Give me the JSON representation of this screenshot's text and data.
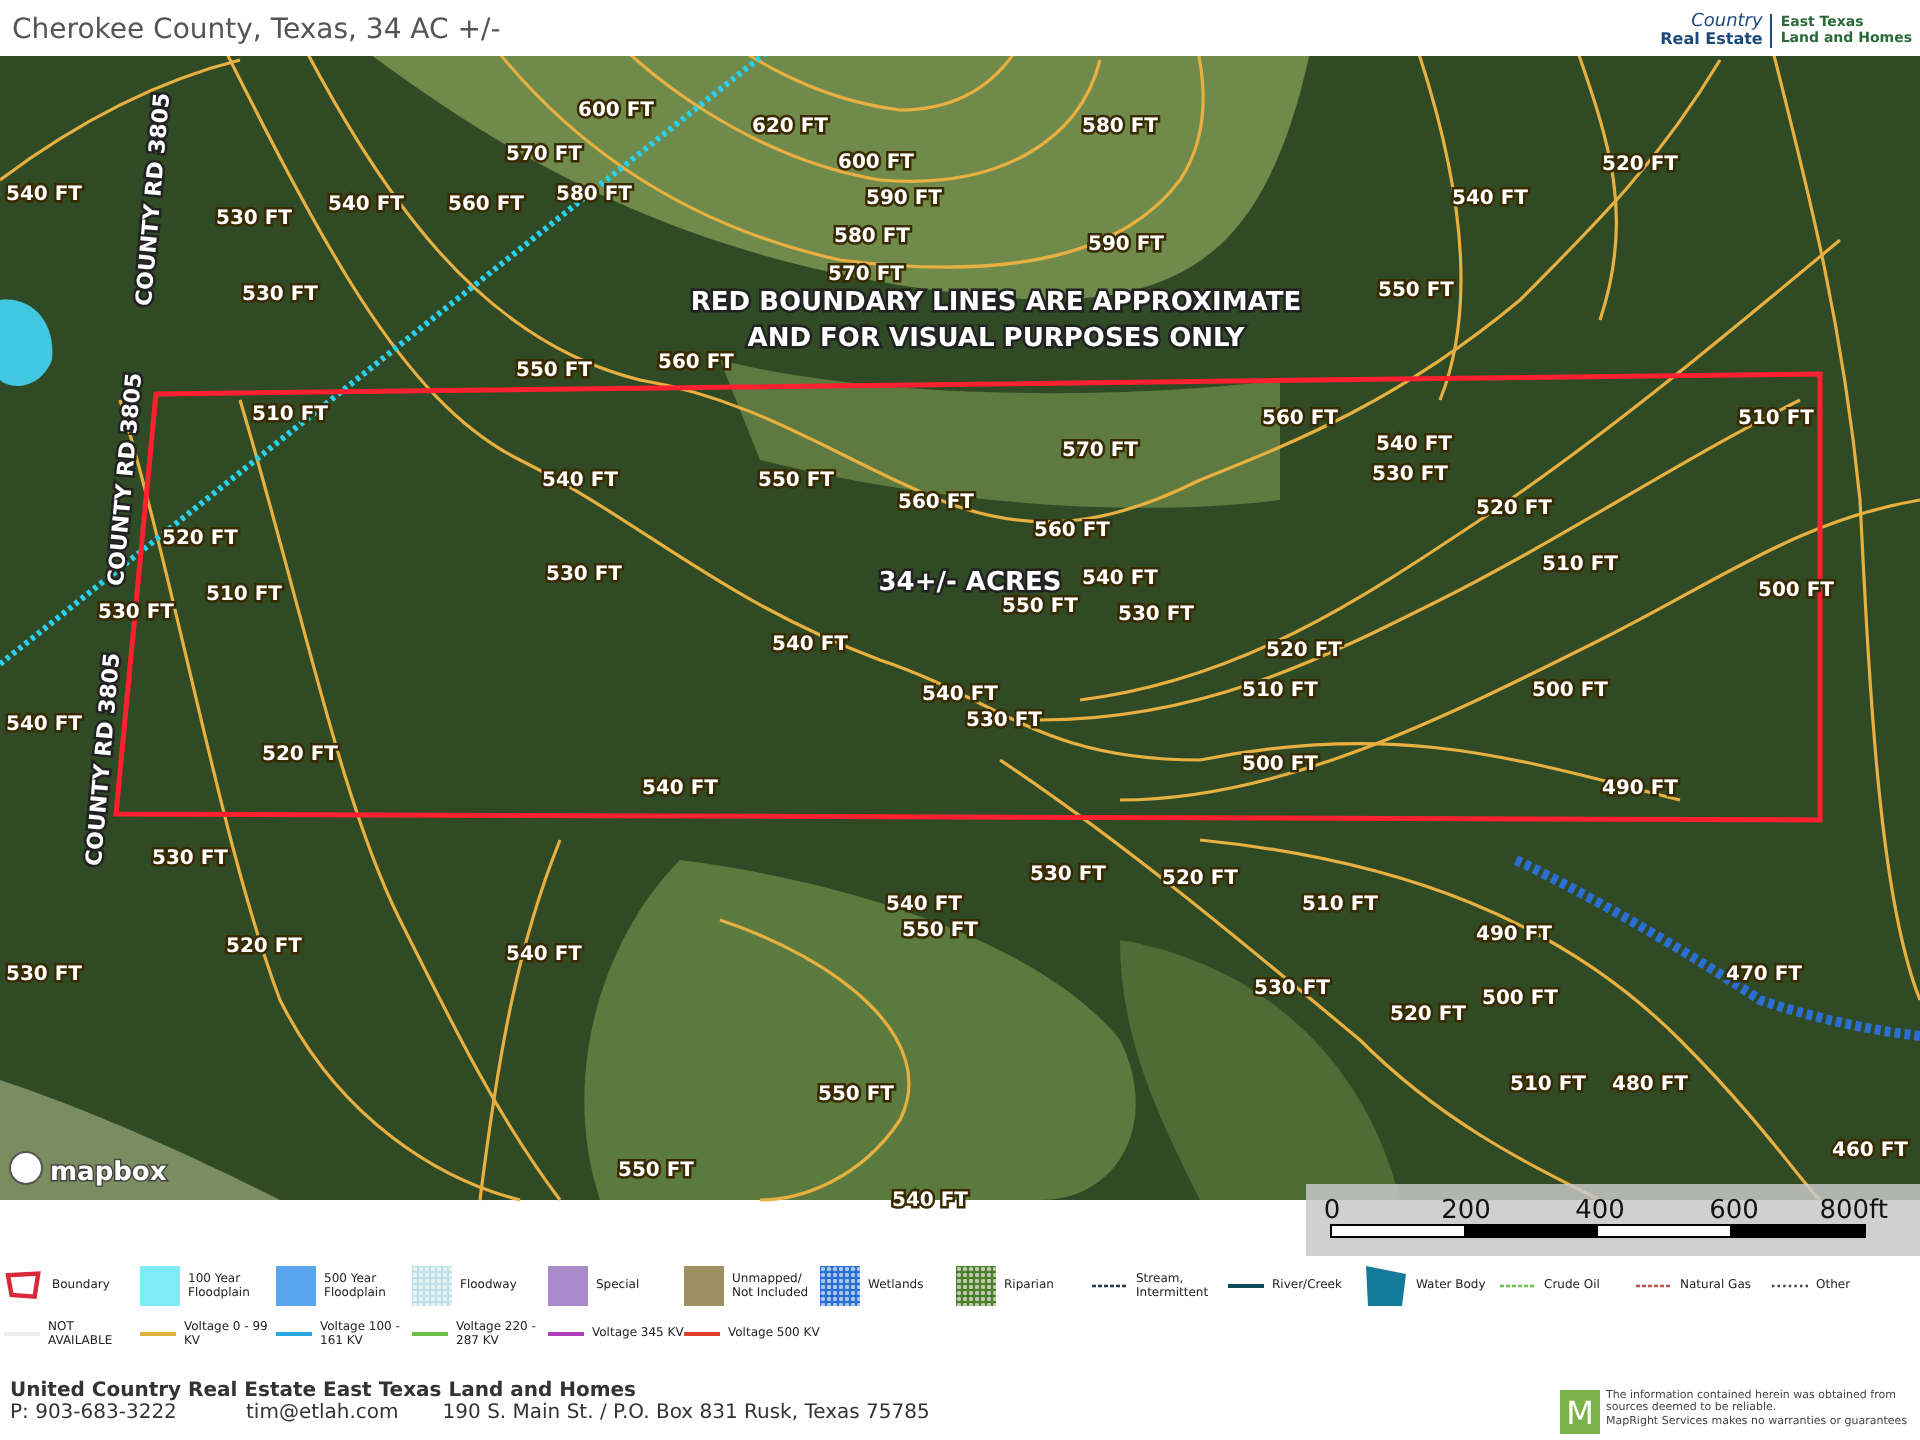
{
  "header": {
    "subtitle": "Cherokee County, Texas, 34 AC +/-",
    "logo": {
      "brand_top": "Country",
      "brand_bottom": "Real Estate",
      "office_top": "East Texas",
      "office_bottom": "Land and Homes"
    }
  },
  "map": {
    "notes": [
      "RED BOUNDARY LINES ARE APPROXIMATE",
      "AND FOR VISUAL PURPOSES ONLY"
    ],
    "acreage": "34+/- ACRES",
    "roads": [
      "COUNTY RD 3805",
      "COUNTY RD 3805",
      "COUNTY RD 3805"
    ],
    "contour_labels": [
      "600 FT",
      "620 FT",
      "580 FT",
      "570 FT",
      "600 FT",
      "520 FT",
      "540 FT",
      "540 FT",
      "560 FT",
      "580 FT",
      "590 FT",
      "540 FT",
      "530 FT",
      "580 FT",
      "590 FT",
      "530 FT",
      "570 FT",
      "550 FT",
      "550 FT",
      "560 FT",
      "510 FT",
      "560 FT",
      "510 FT",
      "570 FT",
      "540 FT",
      "540 FT",
      "550 FT",
      "530 FT",
      "560 FT",
      "520 FT",
      "520 FT",
      "560 FT",
      "530 FT",
      "540 FT",
      "510 FT",
      "530 FT",
      "510 FT",
      "550 FT",
      "530 FT",
      "500 FT",
      "540 FT",
      "520 FT",
      "540 FT",
      "510 FT",
      "500 FT",
      "540 FT",
      "530 FT",
      "520 FT",
      "500 FT",
      "540 FT",
      "490 FT",
      "530 FT",
      "530 FT",
      "520 FT",
      "540 FT",
      "510 FT",
      "550 FT",
      "490 FT",
      "520 FT",
      "540 FT",
      "530 FT",
      "470 FT",
      "530 FT",
      "500 FT",
      "520 FT",
      "510 FT",
      "480 FT",
      "550 FT",
      "460 FT",
      "550 FT",
      "540 FT"
    ],
    "attribution": "mapbox",
    "scale_labels": [
      "0",
      "200",
      "400",
      "600",
      "800ft"
    ]
  },
  "legend": {
    "rows": [
      [
        {
          "kind": "boundary",
          "label": "Boundary",
          "color": "#d8283a"
        },
        {
          "kind": "swatch",
          "label": "100 Year Floodplain",
          "color": "#7eecf5"
        },
        {
          "kind": "swatch",
          "label": "500 Year Floodplain",
          "color": "#5aa6ee"
        },
        {
          "kind": "pattern",
          "label": "Floodway",
          "color": "#bfe0e6"
        },
        {
          "kind": "swatch",
          "label": "Special",
          "color": "#a98bcb"
        },
        {
          "kind": "swatch",
          "label": "Unmapped/ Not Included",
          "color": "#9e9062"
        },
        {
          "kind": "pattern",
          "label": "Wetlands",
          "color": "#2a70d0"
        },
        {
          "kind": "pattern",
          "label": "Riparian",
          "color": "#4f7d2e"
        },
        {
          "kind": "dashed",
          "label": "Stream, Intermittent",
          "color": "#1f3b46"
        },
        {
          "kind": "line",
          "label": "River/Creek",
          "color": "#0d4a5c"
        },
        {
          "kind": "water",
          "label": "Water Body",
          "color": "#137a99"
        },
        {
          "kind": "dashed",
          "label": "Crude Oil",
          "color": "#6cc04a"
        },
        {
          "kind": "dashed",
          "label": "Natural Gas",
          "color": "#c0504a"
        },
        {
          "kind": "dotted",
          "label": "Other",
          "color": "#404040"
        }
      ],
      [
        {
          "kind": "line",
          "label": "NOT AVAILABLE",
          "color": "#eeeeee"
        },
        {
          "kind": "line",
          "label": "Voltage 0 - 99 KV",
          "color": "#e0b040"
        },
        {
          "kind": "line",
          "label": "Voltage 100 - 161 KV",
          "color": "#2aa8e0"
        },
        {
          "kind": "line",
          "label": "Voltage 220 - 287 KV",
          "color": "#6cc04a"
        },
        {
          "kind": "line",
          "label": "Voltage 345 KV",
          "color": "#b040c0"
        },
        {
          "kind": "line",
          "label": "Voltage 500 KV",
          "color": "#e04030"
        }
      ]
    ]
  },
  "footer": {
    "company": "United Country Real Estate East Texas Land and Homes",
    "phone": "P: 903-683-3222",
    "email": "tim@etlah.com",
    "address": "190 S. Main St. / P.O. Box 831 Rusk, Texas 75785",
    "badge": "M",
    "disclaimer": [
      "The information contained herein was obtained from",
      "sources deemed to be reliable.",
      "MapRight Services makes no warranties or guarantees"
    ]
  }
}
